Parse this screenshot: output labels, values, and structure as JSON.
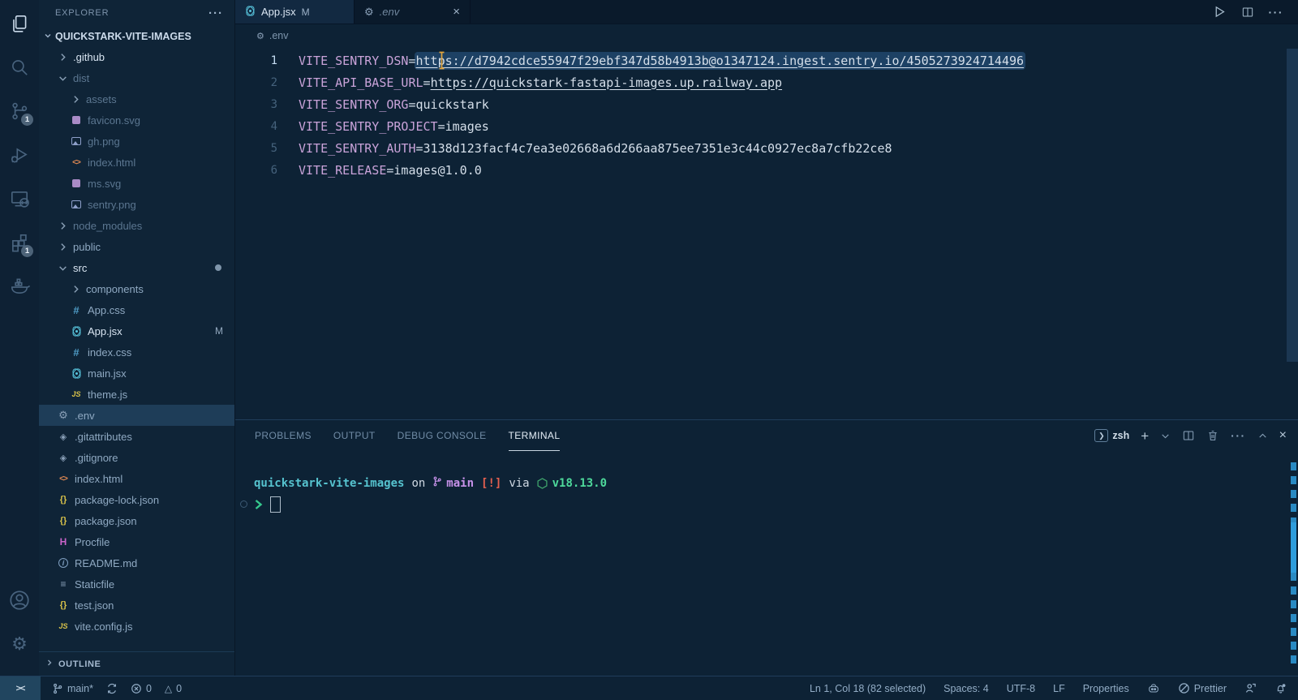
{
  "colors": {
    "accent_blue": "#2e9ddc",
    "selection": "#3a84c6",
    "key_purple": "#c9a3d9",
    "terminal_cyan": "#56c3cf",
    "terminal_green": "#4ed99b",
    "terminal_red": "#e5604f"
  },
  "activity": {
    "top": [
      {
        "name": "explorer",
        "icon": "files",
        "active": true
      },
      {
        "name": "search",
        "icon": "search"
      },
      {
        "name": "source-control",
        "icon": "scm",
        "badge": "1"
      },
      {
        "name": "run-and-debug",
        "icon": "debug"
      },
      {
        "name": "remote-explorer",
        "icon": "remote-explorer"
      },
      {
        "name": "extensions",
        "icon": "extensions",
        "badge": "1"
      },
      {
        "name": "docker",
        "icon": "docker"
      }
    ],
    "bottom": [
      {
        "name": "accounts",
        "icon": "account"
      },
      {
        "name": "settings",
        "icon": "gear-large"
      }
    ]
  },
  "explorer": {
    "title": "EXPLORER",
    "more_label": "···",
    "project": "QUICKSTARK-VITE-IMAGES",
    "outline_label": "OUTLINE",
    "tree": [
      {
        "label": ".github",
        "kind": "folder",
        "expanded": false,
        "depth": 1,
        "tone": "bright"
      },
      {
        "label": "dist",
        "kind": "folder",
        "expanded": true,
        "depth": 1,
        "tone": "dim"
      },
      {
        "label": "assets",
        "kind": "folder",
        "expanded": false,
        "depth": 2,
        "tone": "dim"
      },
      {
        "label": "favicon.svg",
        "kind": "file",
        "icon": "svg",
        "depth": 2,
        "tone": "dim"
      },
      {
        "label": "gh.png",
        "kind": "file",
        "icon": "image",
        "depth": 2,
        "tone": "dim"
      },
      {
        "label": "index.html",
        "kind": "file",
        "icon": "html",
        "depth": 2,
        "tone": "dim"
      },
      {
        "label": "ms.svg",
        "kind": "file",
        "icon": "svg",
        "depth": 2,
        "tone": "dim"
      },
      {
        "label": "sentry.png",
        "kind": "file",
        "icon": "image",
        "depth": 2,
        "tone": "dim"
      },
      {
        "label": "node_modules",
        "kind": "folder",
        "expanded": false,
        "depth": 1,
        "tone": "dim"
      },
      {
        "label": "public",
        "kind": "folder",
        "expanded": false,
        "depth": 1,
        "tone": "normal"
      },
      {
        "label": "src",
        "kind": "folder",
        "expanded": true,
        "depth": 1,
        "tone": "bright",
        "dot": true
      },
      {
        "label": "components",
        "kind": "folder",
        "expanded": false,
        "depth": 2,
        "tone": "normal"
      },
      {
        "label": "App.css",
        "kind": "file",
        "icon": "css",
        "depth": 2,
        "tone": "normal"
      },
      {
        "label": "App.jsx",
        "kind": "file",
        "icon": "react",
        "depth": 2,
        "tone": "bright",
        "badge": "M"
      },
      {
        "label": "index.css",
        "kind": "file",
        "icon": "css",
        "depth": 2,
        "tone": "normal"
      },
      {
        "label": "main.jsx",
        "kind": "file",
        "icon": "react",
        "depth": 2,
        "tone": "normal"
      },
      {
        "label": "theme.js",
        "kind": "file",
        "icon": "js",
        "depth": 2,
        "tone": "normal"
      },
      {
        "label": ".env",
        "kind": "file",
        "icon": "gear",
        "depth": 1,
        "tone": "normal",
        "selected": true
      },
      {
        "label": ".gitattributes",
        "kind": "file",
        "icon": "git",
        "depth": 1,
        "tone": "normal"
      },
      {
        "label": ".gitignore",
        "kind": "file",
        "icon": "git",
        "depth": 1,
        "tone": "normal"
      },
      {
        "label": "index.html",
        "kind": "file",
        "icon": "html",
        "depth": 1,
        "tone": "normal"
      },
      {
        "label": "package-lock.json",
        "kind": "file",
        "icon": "json",
        "depth": 1,
        "tone": "normal"
      },
      {
        "label": "package.json",
        "kind": "file",
        "icon": "json",
        "depth": 1,
        "tone": "normal"
      },
      {
        "label": "Procfile",
        "kind": "file",
        "icon": "heroku",
        "depth": 1,
        "tone": "normal"
      },
      {
        "label": "README.md",
        "kind": "file",
        "icon": "info",
        "depth": 1,
        "tone": "normal"
      },
      {
        "label": "Staticfile",
        "kind": "file",
        "icon": "list",
        "depth": 1,
        "tone": "normal"
      },
      {
        "label": "test.json",
        "kind": "file",
        "icon": "json",
        "depth": 1,
        "tone": "normal"
      },
      {
        "label": "vite.config.js",
        "kind": "file",
        "icon": "js",
        "depth": 1,
        "tone": "normal"
      }
    ]
  },
  "tabs": [
    {
      "label": "App.jsx",
      "icon": "react",
      "badge": "M",
      "active": false
    },
    {
      "label": ".env",
      "icon": "gear",
      "active": true,
      "close_label": "×"
    }
  ],
  "editor_actions": [
    {
      "name": "run-button",
      "icon": "run"
    },
    {
      "name": "split-editor-button",
      "icon": "split"
    },
    {
      "name": "more-actions-button",
      "icon": "ellipsis"
    }
  ],
  "breadcrumb": {
    "icon": "gear",
    "label": ".env"
  },
  "editor": {
    "lines": [
      {
        "num": "1",
        "key": "VITE_SENTRY_DSN",
        "value": "https://d7942cdce55947f29ebf347d58b4913b@o1347124.ingest.sentry.io/4505273924714496",
        "link": true,
        "selected": true,
        "active": true
      },
      {
        "num": "2",
        "key": "VITE_API_BASE_URL",
        "value": "https://quickstark-fastapi-images.up.railway.app",
        "link": true
      },
      {
        "num": "3",
        "key": "VITE_SENTRY_ORG",
        "value": "quickstark"
      },
      {
        "num": "4",
        "key": "VITE_SENTRY_PROJECT",
        "value": "images"
      },
      {
        "num": "5",
        "key": "VITE_SENTRY_AUTH",
        "value": "3138d123facf4c7ea3e02668a6d266aa875ee7351e3c44c0927ec8a7cfb22ce8"
      },
      {
        "num": "6",
        "key": "VITE_RELEASE",
        "value": "images@1.0.0"
      }
    ]
  },
  "panel": {
    "tabs": [
      "PROBLEMS",
      "OUTPUT",
      "DEBUG CONSOLE",
      "TERMINAL"
    ],
    "active_tab": "TERMINAL",
    "controls": [
      {
        "name": "terminal-profile",
        "icon": "shell",
        "label": "zsh"
      },
      {
        "name": "new-terminal-button",
        "icon": "plus"
      },
      {
        "name": "terminal-dropdown",
        "icon": "chevron-down"
      },
      {
        "name": "split-terminal-button",
        "icon": "split"
      },
      {
        "name": "kill-terminal-button",
        "icon": "trash"
      },
      {
        "name": "terminal-more-button",
        "icon": "ellipsis"
      },
      {
        "name": "maximize-panel-button",
        "icon": "chevron-up"
      },
      {
        "name": "close-panel-button",
        "icon": "close"
      }
    ],
    "prompt": {
      "dir": "quickstark-vite-images",
      "on_word": "on",
      "branch": "main",
      "git_status": "[!]",
      "via_word": "via",
      "node_version": "v18.13.0"
    }
  },
  "status_bar": {
    "remote_label": "><",
    "left": [
      {
        "name": "git-branch",
        "icon": "branch",
        "label": "main*"
      },
      {
        "name": "sync",
        "icon": "sync",
        "label": ""
      },
      {
        "name": "errors",
        "icon": "error",
        "label": "0"
      },
      {
        "name": "warnings",
        "icon": "warning",
        "label": "0"
      }
    ],
    "right": [
      {
        "name": "cursor-position",
        "label": "Ln 1, Col 18 (82 selected)"
      },
      {
        "name": "indentation",
        "label": "Spaces: 4"
      },
      {
        "name": "encoding",
        "label": "UTF-8"
      },
      {
        "name": "eol",
        "label": "LF"
      },
      {
        "name": "language-mode",
        "label": "Properties"
      },
      {
        "name": "copilot",
        "icon": "copilot",
        "label": ""
      },
      {
        "name": "formatter",
        "icon": "prettier",
        "label": "Prettier"
      },
      {
        "name": "feedback",
        "icon": "feedback",
        "label": ""
      },
      {
        "name": "notifications",
        "icon": "bell-dot",
        "label": ""
      }
    ]
  }
}
